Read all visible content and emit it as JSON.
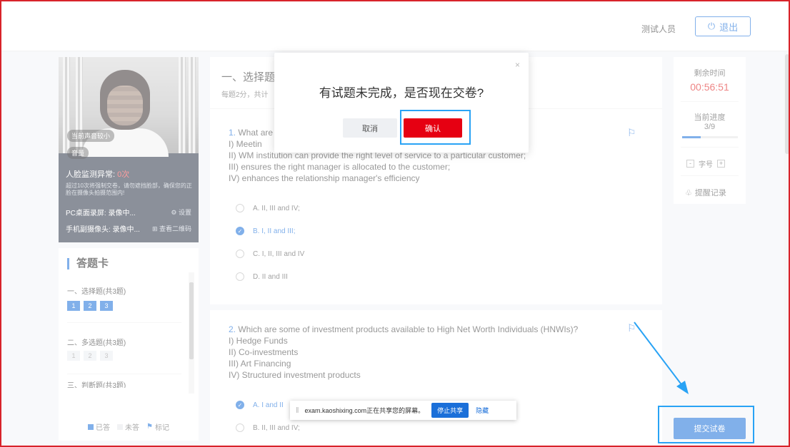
{
  "header": {
    "user_name": "测试人员",
    "logout_label": "退出",
    "logout_icon": "power-icon"
  },
  "monitor": {
    "voice_tag": "当前声音较小",
    "volume_tag": "音量",
    "face_alert_label": "人脸监测异常:",
    "face_alert_count": "0次",
    "face_tip": "超过10次将强制交卷，请勿遮挡脸部，确保您的正脸在摄像头拍摄范围内!",
    "pc_record_status": "PC桌面录屏: 录像中...",
    "pc_settings": "设置",
    "phone_camera_status": "手机副摄像头: 录像中...",
    "phone_qr": "查看二维码"
  },
  "answer_card": {
    "title": "答题卡",
    "sections": [
      {
        "label": "一、选择题(共3题)",
        "numbers": [
          "1",
          "2",
          "3"
        ],
        "done": [
          true,
          true,
          true
        ]
      },
      {
        "label": "二、多选题(共3题)",
        "numbers": [
          "1",
          "2",
          "3"
        ],
        "done": [
          false,
          false,
          false
        ]
      },
      {
        "label": "三、判断题(共3题)"
      }
    ],
    "legend": {
      "answered": "已答",
      "unanswered": "未答",
      "marked": "标记"
    },
    "colors": {
      "answered": "#1a6fd9",
      "unanswered": "#e6e8ec",
      "marked": "#1a6fd9"
    }
  },
  "main": {
    "section_title": "一、选择题",
    "section_sub": "每题2分，共计",
    "q1": {
      "number": "1.",
      "text": "What are\nI) Meetin\nII) WM institution can provide the right level of service to a particular customer;\nIII) ensures the right manager is allocated to the customer;\nIV) enhances the relationship manager's efficiency",
      "options": [
        {
          "label": "A. II, III and IV;",
          "selected": false
        },
        {
          "label": "B. I, II and III;",
          "selected": true
        },
        {
          "label": "C. I, II, III and IV",
          "selected": false
        },
        {
          "label": "D. II and III",
          "selected": false
        }
      ]
    },
    "q2": {
      "number": "2.",
      "text": "Which are some of investment products available to High Net Worth Individuals (HNWIs)?\nI) Hedge Funds\nII) Co-investments\nIII) Art Financing\nIV) Structured investment products",
      "options": [
        {
          "label": "A. I and II",
          "selected": true
        },
        {
          "label": "B. II, III and IV;",
          "selected": false
        }
      ]
    },
    "flag_icon": "flag-icon"
  },
  "status": {
    "remaining_label": "剩余时间",
    "remaining_time": "00:56:51",
    "progress_label": "当前进度",
    "progress_text": "3/9",
    "progress_fraction": 0.333,
    "font_label": "字号",
    "font_minus": "-",
    "font_plus": "+",
    "remind_label": "提醒记录",
    "submit_label": "提交试卷"
  },
  "dialog": {
    "message": "有试题未完成，是否现在交卷?",
    "cancel": "取消",
    "confirm": "确认",
    "close": "×"
  },
  "share_bar": {
    "text": "exam.kaoshixing.com正在共享您的屏幕。",
    "stop": "停止共享",
    "hide": "隐藏"
  }
}
